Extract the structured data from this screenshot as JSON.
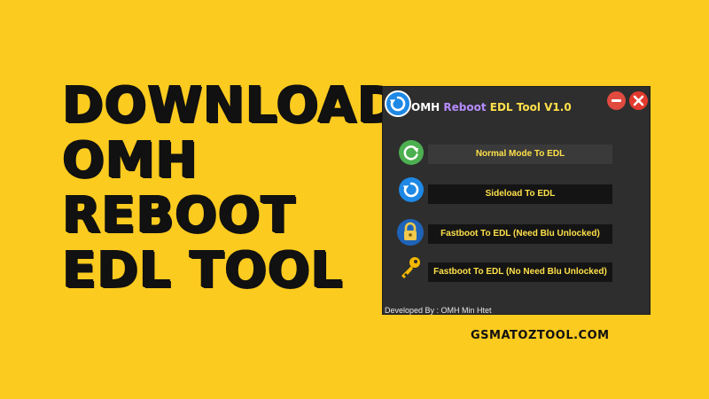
{
  "headline": {
    "line1": "DOWNLOAD",
    "line2": "OMH",
    "line3": "REBOOT",
    "line4": "EDL TOOL"
  },
  "app_window": {
    "title_omh": "OMH",
    "title_reboot": "Reboot",
    "title_edl": "EDL Tool",
    "title_version": "V1.0",
    "buttons": [
      {
        "label": "Normal Mode To EDL",
        "icon": "refresh-icon"
      },
      {
        "label": "Sideload To EDL",
        "icon": "reload-icon"
      },
      {
        "label": "Fastboot To EDL (Need Blu Unlocked)",
        "icon": "lock-icon"
      },
      {
        "label": "Fastboot To EDL (No Need Blu Unlocked)",
        "icon": "key-icon"
      }
    ],
    "footer": "Developed By : OMH Min Htet"
  },
  "website": "GSMATOZTOOL.COM",
  "colors": {
    "background": "#FCCB1F",
    "window": "#2E2E2E",
    "button_text": "#FFE14A",
    "close": "#E23A2E"
  }
}
